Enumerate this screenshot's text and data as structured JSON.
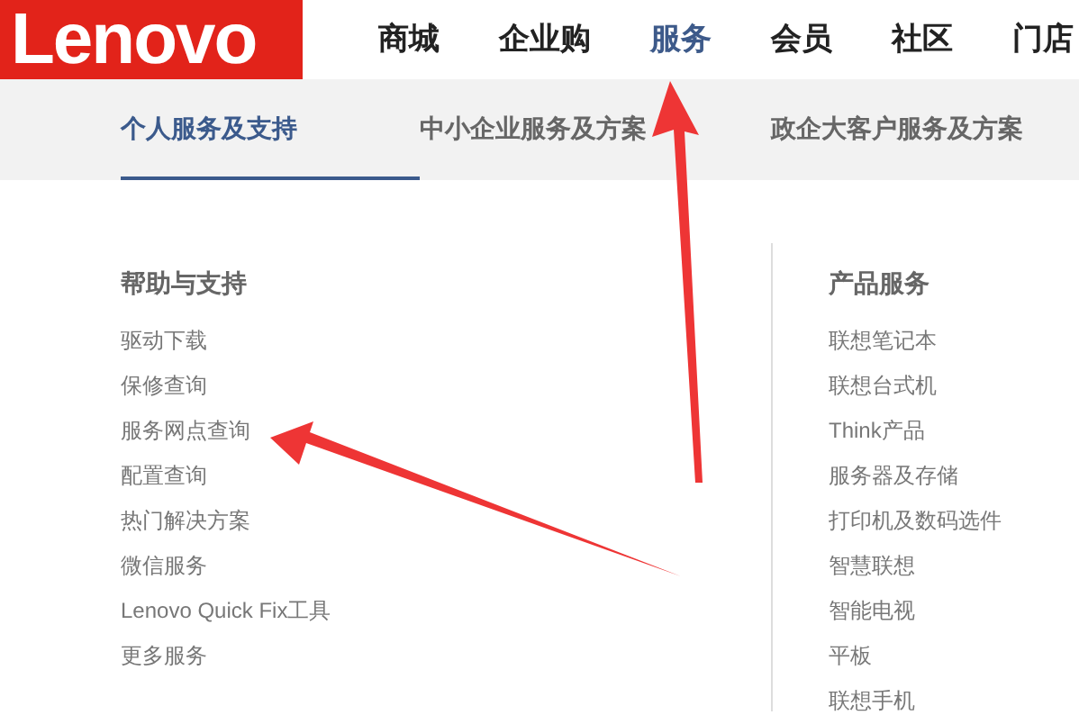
{
  "logo": {
    "text": "Lenovo"
  },
  "nav": [
    {
      "label": "商城",
      "selected": false
    },
    {
      "label": "企业购",
      "selected": false
    },
    {
      "label": "服务",
      "selected": true
    },
    {
      "label": "会员",
      "selected": false
    },
    {
      "label": "社区",
      "selected": false
    },
    {
      "label": "门店",
      "selected": false
    }
  ],
  "tabs": [
    {
      "label": "个人服务及支持",
      "selected": true
    },
    {
      "label": "中小企业服务及方案",
      "selected": false
    },
    {
      "label": "政企大客户服务及方案",
      "selected": false
    }
  ],
  "columns": [
    {
      "heading": "帮助与支持",
      "items": [
        "驱动下载",
        "保修查询",
        "服务网点查询",
        "配置查询",
        "热门解决方案",
        "微信服务",
        "Lenovo Quick Fix工具",
        "更多服务"
      ]
    },
    {
      "heading": "产品服务",
      "items": [
        "联想笔记本",
        "联想台式机",
        "Think产品",
        "服务器及存储",
        "打印机及数码选件",
        "智慧联想",
        "智能电视",
        "平板",
        "联想手机"
      ]
    }
  ]
}
